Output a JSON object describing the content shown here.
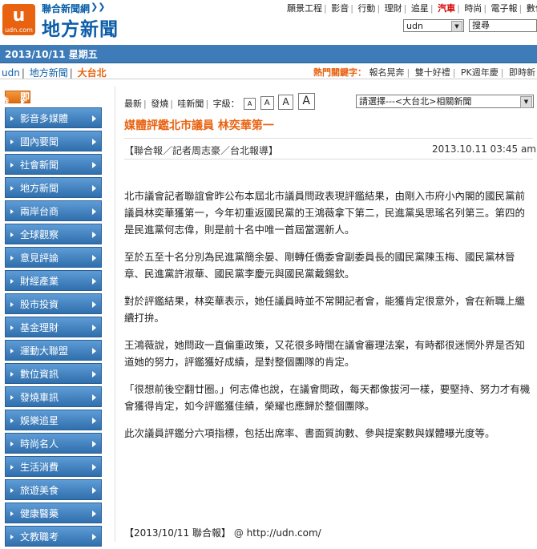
{
  "header": {
    "logo_glyph": "u",
    "logo_text": "udn.com",
    "site_small": "聯合新聞網",
    "site_big": "地方新聞",
    "top_nav": [
      "願景工程",
      "影音",
      "行動",
      "理財",
      "追星",
      "汽車",
      "時尚",
      "電子報",
      "數位閱"
    ],
    "top_nav_hot": "汽車",
    "search_scope": "udn",
    "search_placeholder": "搜尋"
  },
  "datebar": {
    "date": "2013/10/11 星期五"
  },
  "breadcrumb": [
    "udn",
    "地方新聞",
    "大台北"
  ],
  "hotkeys": {
    "label": "熱門關鍵字：",
    "items": [
      "報名晃奔",
      "雙十好禮",
      "PK週年慶",
      "即時新"
    ]
  },
  "sidebar": {
    "first": {
      "left": "即",
      "right": "時"
    },
    "items": [
      "影音多媒體",
      "國內要聞",
      "社會新聞",
      "地方新聞",
      "兩岸台商",
      "全球觀察",
      "意見評論",
      "財經產業",
      "股市投資",
      "基金理財",
      "運動大聯盟",
      "數位資訊",
      "發燒車訊",
      "娛樂追星",
      "時尚名人",
      "生活消費",
      "旅遊美食",
      "健康醫藥",
      "文教職考"
    ]
  },
  "article": {
    "tools": {
      "newest": "最新",
      "post": "發燒",
      "share": "哇新聞",
      "fontsize_label": "字級：",
      "sizes": [
        "A",
        "A",
        "A",
        "A"
      ]
    },
    "related_select": "請選擇---<大台北>相關新聞",
    "title": "媒體評鑑北市議員 林奕華第一",
    "byline": "【聯合報／記者周志豪／台北報導】",
    "time": "2013.10.11 03:45 am",
    "paragraphs": [
      "北市議會記者聯誼會昨公布本屆北市議員問政表現評鑑結果，由剛入市府小內閣的國民黨前議員林奕華獲第一，今年初重返國民黨的王鴻薇拿下第二，民進黨吳思瑤名列第三。第四的是民進黨何志偉，則是前十名中唯一首屆當選新人。",
      "至於五至十名分別為民進黨簡余晏、剛轉任僑委會副委員長的國民黨陳玉梅、國民黨林晉章、民進黨許淑華、國民黨李慶元與國民黨戴錫欽。",
      "對於評鑑結果，林奕華表示，她任議員時並不常開記者會，能獲肯定很意外，會在新職上繼續打拚。",
      "王鴻薇說，她問政一直偏重政策，又花很多時間在議會審理法案，有時都很迷惘外界是否知道她的努力，評鑑獲好成績，是對整個團隊的肯定。",
      "「很想前後空翻廿圈。」何志偉也說，在議會問政，每天都像拔河一樣，要堅持、努力才有機會獲得肯定，如今評鑑獲佳績，榮耀也應歸於整個團隊。",
      "此次議員評鑑分六項指標，包括出席率、書面質詢數、參與提案數與媒體曝光度等。"
    ],
    "footer_source": "【2013/10/11 聯合報】",
    "footer_at": "@",
    "footer_url": "http://udn.com/"
  }
}
